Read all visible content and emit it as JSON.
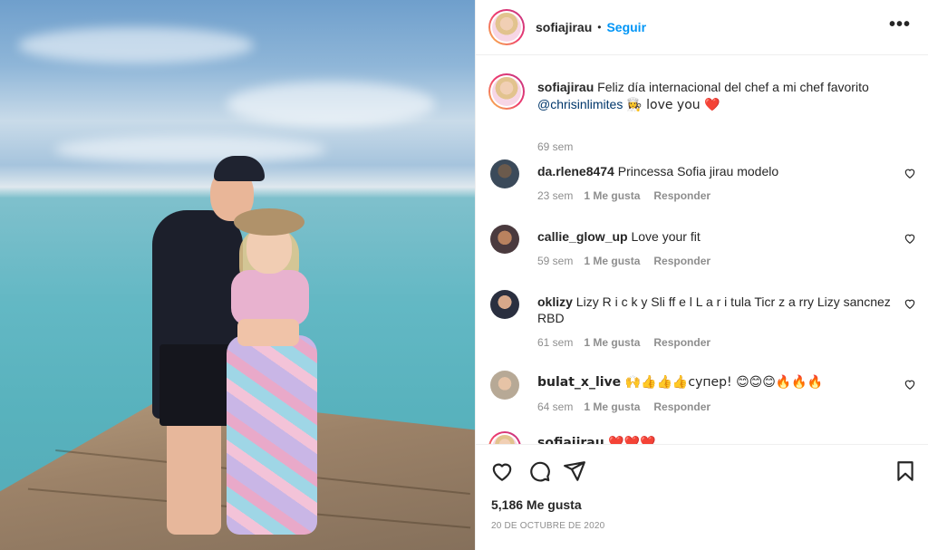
{
  "post": {
    "username": "sofiajirau",
    "separator": "•",
    "follow_label": "Seguir",
    "more_label": "•••"
  },
  "caption": {
    "username": "sofiajirau",
    "text_before": "Feliz día internacional del chef a mi chef favorito",
    "mention": "@chrisinlimites",
    "text_after": "👩‍🍳 love you ❤️",
    "time": "69 sem"
  },
  "comments": [
    {
      "username": "da.rlene8474",
      "text": "Princessa Sofia jirau modelo",
      "time": "23 sem",
      "likes": "1 Me gusta",
      "reply": "Responder"
    },
    {
      "username": "callie_glow_up",
      "text": "Love your fit",
      "time": "59 sem",
      "likes": "1 Me gusta",
      "reply": "Responder"
    },
    {
      "username": "oklizy",
      "text": "Lizy R i c k y Sli ff e l L a r i tula Ticr z a rry Lizy sancnez RBD",
      "time": "61 sem",
      "likes": "1 Me gusta",
      "reply": "Responder"
    },
    {
      "username": "bulat_x_live",
      "text": "🙌👍👍👍супер! 😊😊😊🔥🔥🔥",
      "time": "64 sem",
      "likes": "1 Me gusta",
      "reply": "Responder"
    },
    {
      "username": "sofiajirau",
      "text": "❤️❤️❤️"
    }
  ],
  "footer": {
    "likes": "5,186 Me gusta",
    "date": "20 DE OCTUBRE DE 2020"
  },
  "icons": {
    "like": "heart-icon",
    "comment": "comment-icon",
    "share": "share-icon",
    "save": "bookmark-icon",
    "more": "more-options-icon"
  },
  "colors": {
    "follow": "#0095f6",
    "mention": "#00376b",
    "muted": "#8e8e8e",
    "text": "#262626"
  }
}
